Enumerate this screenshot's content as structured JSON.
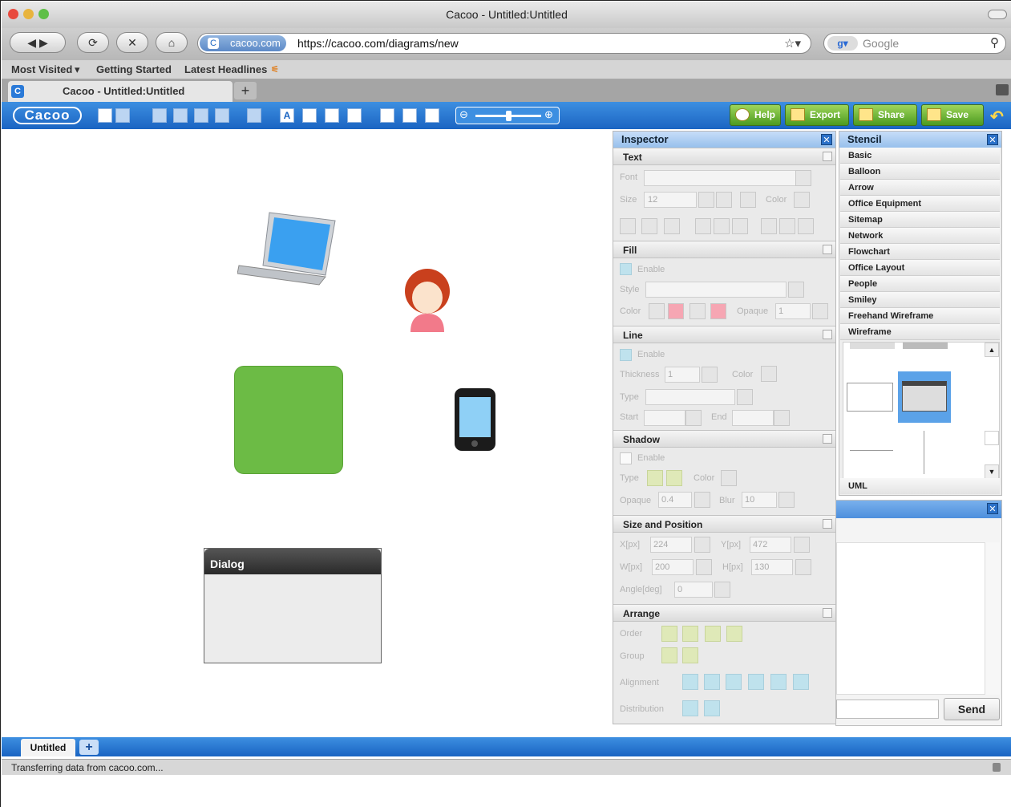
{
  "window": {
    "title": "Cacoo - Untitled:Untitled"
  },
  "navigation": {
    "site_label": "cacoo.com",
    "url": "https://cacoo.com/diagrams/new",
    "search_placeholder": "Google"
  },
  "bookmarks": [
    "Most Visited",
    "Getting Started",
    "Latest Headlines"
  ],
  "tabs": [
    {
      "label": "Cacoo - Untitled:Untitled"
    }
  ],
  "app_toolbar": {
    "logo": "Cacoo",
    "help": "Help",
    "export": "Export",
    "share": "Share",
    "save": "Save"
  },
  "canvas": {
    "dialog_title": "Dialog",
    "rect_color": "#6cbb45"
  },
  "inspector": {
    "title": "Inspector",
    "sections": {
      "text": "Text",
      "fill": "Fill",
      "line": "Line",
      "shadow": "Shadow",
      "size_position": "Size and Position",
      "arrange": "Arrange"
    },
    "labels": {
      "font": "Font",
      "size": "Size",
      "color": "Color",
      "enable": "Enable",
      "style": "Style",
      "opaque": "Opaque",
      "thickness": "Thickness",
      "type": "Type",
      "start": "Start",
      "end": "End",
      "blur": "Blur",
      "x": "X[px]",
      "y": "Y[px]",
      "w": "W[px]",
      "h": "H[px]",
      "angle": "Angle[deg]",
      "order": "Order",
      "group": "Group",
      "alignment": "Alignment",
      "distribution": "Distribution"
    },
    "values": {
      "size": "12",
      "fill_opaque": "1",
      "thickness": "1",
      "shadow_opaque": "0.4",
      "blur": "10",
      "x": "224",
      "y": "472",
      "w": "200",
      "h": "130",
      "angle": "0"
    }
  },
  "stencil": {
    "title": "Stencil",
    "items": [
      "Basic",
      "Balloon",
      "Arrow",
      "Office Equipment",
      "Sitemap",
      "Network",
      "Flowchart",
      "Office Layout",
      "People",
      "Smiley",
      "Freehand Wireframe",
      "Wireframe"
    ],
    "footer_item": "UML"
  },
  "chat": {
    "send_label": "Send"
  },
  "pages": {
    "tab": "Untitled",
    "add": "+"
  },
  "status": "Transferring data from cacoo.com..."
}
